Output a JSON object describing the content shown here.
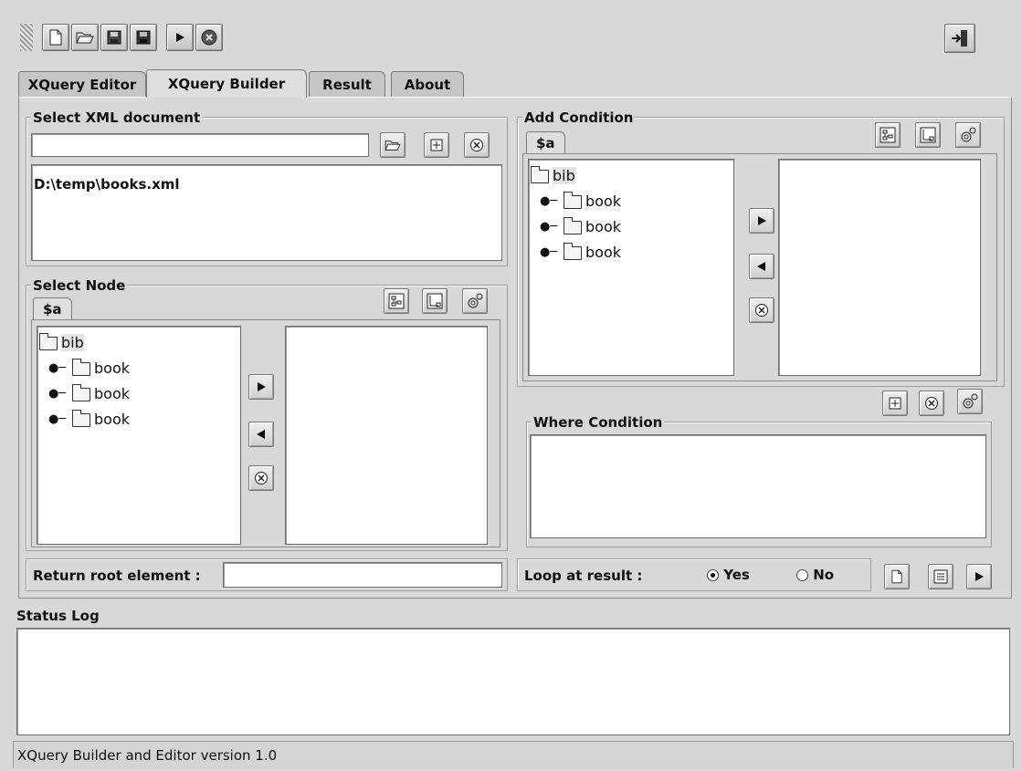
{
  "toolbar": {
    "buttons": [
      {
        "name": "new-file-button",
        "icon": "new-file-icon"
      },
      {
        "name": "open-file-button",
        "icon": "open-folder-icon"
      },
      {
        "name": "save-button",
        "icon": "save-icon"
      },
      {
        "name": "save-as-button",
        "icon": "save-as-icon"
      },
      {
        "name": "run-button",
        "icon": "play-icon"
      },
      {
        "name": "stop-button",
        "icon": "stop-icon"
      }
    ],
    "exit_icon": "exit-icon"
  },
  "tabs": [
    {
      "label": "XQuery Editor",
      "active": false
    },
    {
      "label": "XQuery Builder",
      "active": true
    },
    {
      "label": "Result",
      "active": false
    },
    {
      "label": "About",
      "active": false
    }
  ],
  "select_xml": {
    "title": "Select XML document",
    "path_value": "",
    "documents": [
      "D:\\temp\\books.xml"
    ]
  },
  "select_node": {
    "title": "Select Node",
    "subtab": "$a",
    "tree": {
      "root": "bib",
      "children": [
        "book",
        "book",
        "book"
      ]
    }
  },
  "add_condition": {
    "title": "Add Condition",
    "subtab": "$a",
    "tree": {
      "root": "bib",
      "children": [
        "book",
        "book",
        "book"
      ]
    }
  },
  "where_condition": {
    "title": "Where Condition"
  },
  "bottom": {
    "return_label": "Return root element :",
    "return_value": "",
    "loop_label": "Loop at result :",
    "yes_label": "Yes",
    "no_label": "No",
    "loop_selected": "Yes"
  },
  "status": {
    "title": "Status Log",
    "footer": "XQuery Builder and Editor version 1.0"
  }
}
